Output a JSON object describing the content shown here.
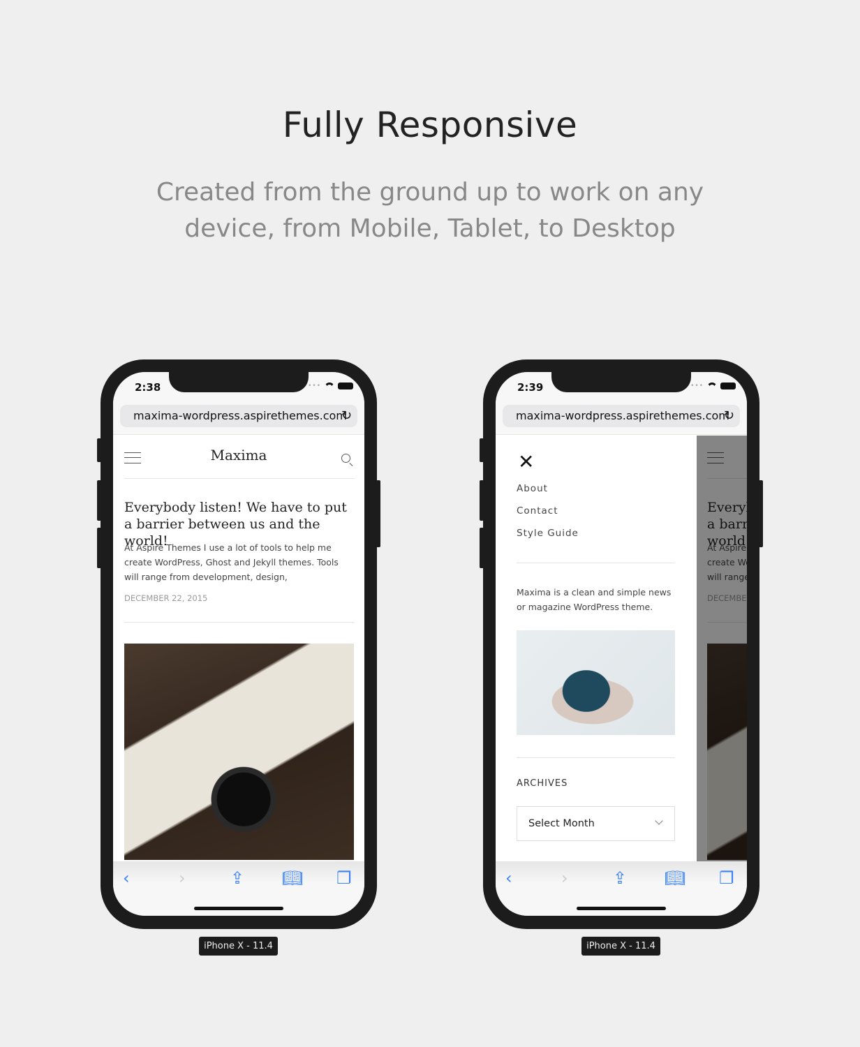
{
  "hero": {
    "title": "Fully Responsive",
    "subtitle": "Created from the ground up to work on any device, from Mobile, Tablet, to Desktop"
  },
  "phones": [
    {
      "time": "2:38",
      "url": "maxima-wordpress.aspirethemes.com",
      "device_label": "iPhone X - 11.4"
    },
    {
      "time": "2:39",
      "url": "maxima-wordpress.aspirethemes.com",
      "device_label": "iPhone X - 11.4"
    }
  ],
  "site": {
    "logo": "Maxima",
    "post": {
      "title": "Everybody listen! We have to put a barrier between us and the world!",
      "excerpt": "At Aspire Themes I use a lot of tools to help me create WordPress, Ghost and Jekyll themes. Tools will range from development, design,",
      "date": "DECEMBER 22, 2015"
    },
    "menu": {
      "items": [
        "About",
        "Contact",
        "Style Guide"
      ],
      "description": "Maxima is a clean and simple news or magazine WordPress theme.",
      "archives_heading": "ARCHIVES",
      "archives_select": "Select Month"
    }
  },
  "icons": {
    "reload": "reload-icon",
    "back": "chevron-left-icon",
    "forward": "chevron-right-icon",
    "share": "share-icon",
    "bookmarks": "book-icon",
    "tabs": "tabs-icon"
  },
  "colors": {
    "toolbar_accent": "#3b82f6",
    "background": "#efefef",
    "phone_frame": "#1c1c1c"
  }
}
